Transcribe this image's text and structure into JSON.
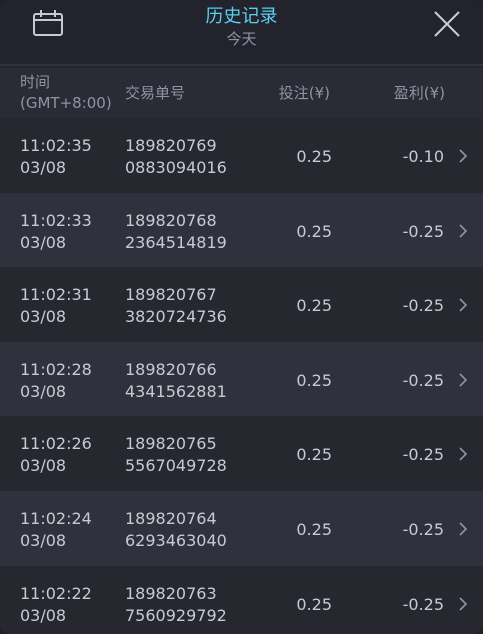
{
  "header": {
    "title": "历史记录",
    "subtitle": "今天"
  },
  "columns": {
    "time_line1": "时间",
    "time_line2": "(GMT+8:00)",
    "order_id": "交易单号",
    "bet": "投注(¥)",
    "profit": "盈利(¥)"
  },
  "rows": [
    {
      "time": "11:02:35",
      "date": "03/08",
      "id_line1": "189820769",
      "id_line2": "0883094016",
      "bet": "0.25",
      "profit": "-0.10"
    },
    {
      "time": "11:02:33",
      "date": "03/08",
      "id_line1": "189820768",
      "id_line2": "2364514819",
      "bet": "0.25",
      "profit": "-0.25"
    },
    {
      "time": "11:02:31",
      "date": "03/08",
      "id_line1": "189820767",
      "id_line2": "3820724736",
      "bet": "0.25",
      "profit": "-0.25"
    },
    {
      "time": "11:02:28",
      "date": "03/08",
      "id_line1": "189820766",
      "id_line2": "4341562881",
      "bet": "0.25",
      "profit": "-0.25"
    },
    {
      "time": "11:02:26",
      "date": "03/08",
      "id_line1": "189820765",
      "id_line2": "5567049728",
      "bet": "0.25",
      "profit": "-0.25"
    },
    {
      "time": "11:02:24",
      "date": "03/08",
      "id_line1": "189820764",
      "id_line2": "6293463040",
      "bet": "0.25",
      "profit": "-0.25"
    },
    {
      "time": "11:02:22",
      "date": "03/08",
      "id_line1": "189820763",
      "id_line2": "7560929792",
      "bet": "0.25",
      "profit": "-0.25"
    }
  ],
  "icons": {
    "calendar": "calendar-icon",
    "close": "close-icon",
    "chevron": "chevron-right-icon"
  },
  "colors": {
    "title": "#5ad0ee",
    "text": "#c8cad3",
    "muted": "#8f93a3"
  }
}
